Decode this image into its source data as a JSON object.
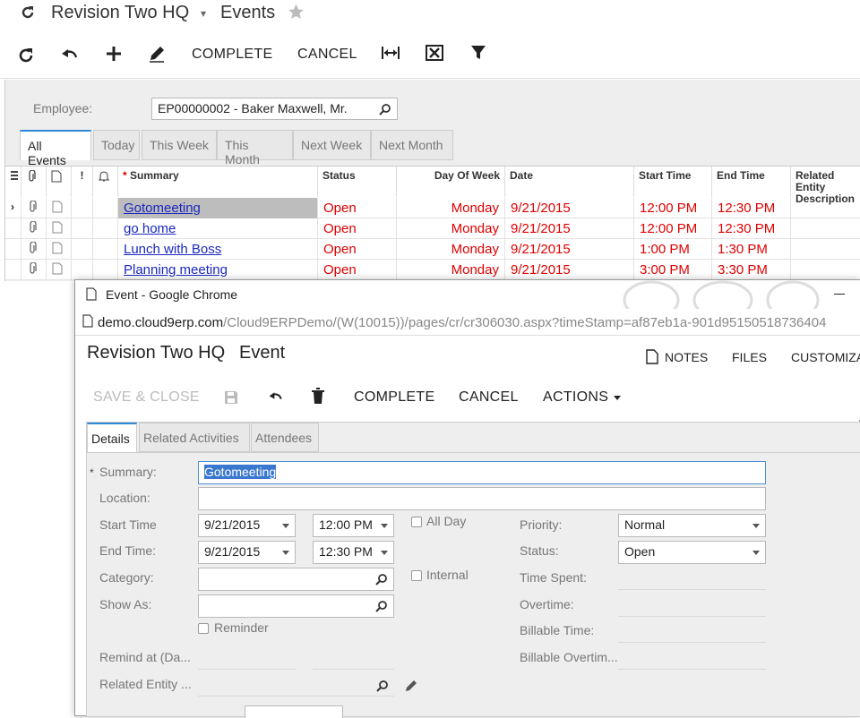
{
  "header": {
    "site": "Revision Two HQ",
    "separator": "▾",
    "screen": "Events"
  },
  "toolbar": {
    "complete": "COMPLETE",
    "cancel": "CANCEL"
  },
  "filter": {
    "employee_label": "Employee:",
    "employee_value": "EP00000002 - Baker Maxwell, Mr."
  },
  "tabs": [
    "All Events",
    "Today",
    "This Week",
    "This Month",
    "Next Week",
    "Next Month"
  ],
  "grid": {
    "headers": {
      "summary": "Summary",
      "required": "*",
      "status": "Status",
      "dow": "Day Of Week",
      "date": "Date",
      "start": "Start Time",
      "end": "End Time",
      "related": "Related Entity Description"
    },
    "rows": [
      {
        "summary": "Gotomeeting",
        "status": "Open",
        "dow": "Monday",
        "date": "9/21/2015",
        "start": "12:00 PM",
        "end": "12:30 PM"
      },
      {
        "summary": "go home",
        "status": "Open",
        "dow": "Monday",
        "date": "9/21/2015",
        "start": "12:00 PM",
        "end": "12:30 PM"
      },
      {
        "summary": "Lunch with Boss",
        "status": "Open",
        "dow": "Monday",
        "date": "9/21/2015",
        "start": "1:00 PM",
        "end": "1:30 PM"
      },
      {
        "summary": "Planning meeting",
        "status": "Open",
        "dow": "Monday",
        "date": "9/21/2015",
        "start": "3:00 PM",
        "end": "3:30 PM"
      }
    ]
  },
  "popup": {
    "window_title": "Event - Google Chrome",
    "url_host": "demo.cloud9erp.com",
    "url_path": "/Cloud9ERPDemo/(W(10015))/pages/cr/cr306030.aspx?timeStamp=af87eb1a-901d95150518736404",
    "form_site": "Revision Two HQ",
    "form_title": "Event",
    "notes": "NOTES",
    "files": "FILES",
    "customize": "CUSTOMIZA",
    "save_close": "SAVE & CLOSE",
    "complete": "COMPLETE",
    "cancel": "CANCEL",
    "actions": "ACTIONS",
    "tabs": [
      "Details",
      "Related Activities",
      "Attendees"
    ],
    "fields": {
      "summary_label": "Summary:",
      "summary_value": "Gotomeeting",
      "location_label": "Location:",
      "start_label": "Start Time",
      "start_date": "9/21/2015",
      "start_time": "12:00 PM",
      "end_label": "End Time:",
      "end_date": "9/21/2015",
      "end_time": "12:30 PM",
      "allday_label": "All Day",
      "internal_label": "Internal",
      "category_label": "Category:",
      "showas_label": "Show As:",
      "reminder_label": "Reminder",
      "remind_at_label": "Remind at (Da...",
      "related_label": "Related Entity ...",
      "priority_label": "Priority:",
      "priority_value": "Normal",
      "status_label": "Status:",
      "status_value": "Open",
      "time_spent_label": "Time Spent:",
      "overtime_label": "Overtime:",
      "billable_label": "Billable Time:",
      "billable_ot_label": "Billable Overtim..."
    }
  }
}
